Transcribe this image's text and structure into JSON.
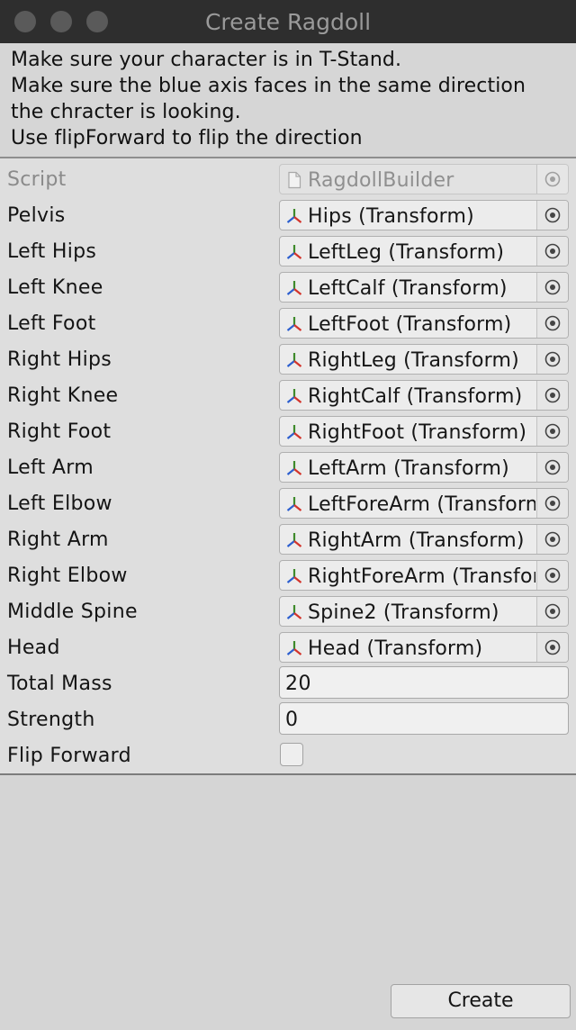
{
  "window": {
    "title": "Create Ragdoll"
  },
  "help_lines": [
    "Make sure your character is in T-Stand.",
    "Make sure the blue axis faces in the same direction",
    "the chracter is looking.",
    "Use flipForward to flip the direction"
  ],
  "fields": [
    {
      "label": "Script",
      "value": "RagdollBuilder",
      "icon": "script-file-icon"
    },
    {
      "label": "Pelvis",
      "value": "Hips (Transform)",
      "icon": "transform-icon"
    },
    {
      "label": "Left Hips",
      "value": "LeftLeg (Transform)",
      "icon": "transform-icon"
    },
    {
      "label": "Left Knee",
      "value": "LeftCalf (Transform)",
      "icon": "transform-icon"
    },
    {
      "label": "Left Foot",
      "value": "LeftFoot (Transform)",
      "icon": "transform-icon"
    },
    {
      "label": "Right Hips",
      "value": "RightLeg (Transform)",
      "icon": "transform-icon"
    },
    {
      "label": "Right Knee",
      "value": "RightCalf (Transform)",
      "icon": "transform-icon"
    },
    {
      "label": "Right Foot",
      "value": "RightFoot (Transform)",
      "icon": "transform-icon"
    },
    {
      "label": "Left Arm",
      "value": "LeftArm (Transform)",
      "icon": "transform-icon"
    },
    {
      "label": "Left Elbow",
      "value": "LeftForeArm (Transform)",
      "icon": "transform-icon"
    },
    {
      "label": "Right Arm",
      "value": "RightArm (Transform)",
      "icon": "transform-icon"
    },
    {
      "label": "Right Elbow",
      "value": "RightForeArm (Transform)",
      "icon": "transform-icon"
    },
    {
      "label": "Middle Spine",
      "value": "Spine2 (Transform)",
      "icon": "transform-icon"
    },
    {
      "label": "Head",
      "value": "Head (Transform)",
      "icon": "transform-icon"
    }
  ],
  "total_mass": {
    "label": "Total Mass",
    "value": "20"
  },
  "strength": {
    "label": "Strength",
    "value": "0"
  },
  "flip_forward": {
    "label": "Flip Forward",
    "checked": false
  },
  "create_button": {
    "label": "Create"
  }
}
